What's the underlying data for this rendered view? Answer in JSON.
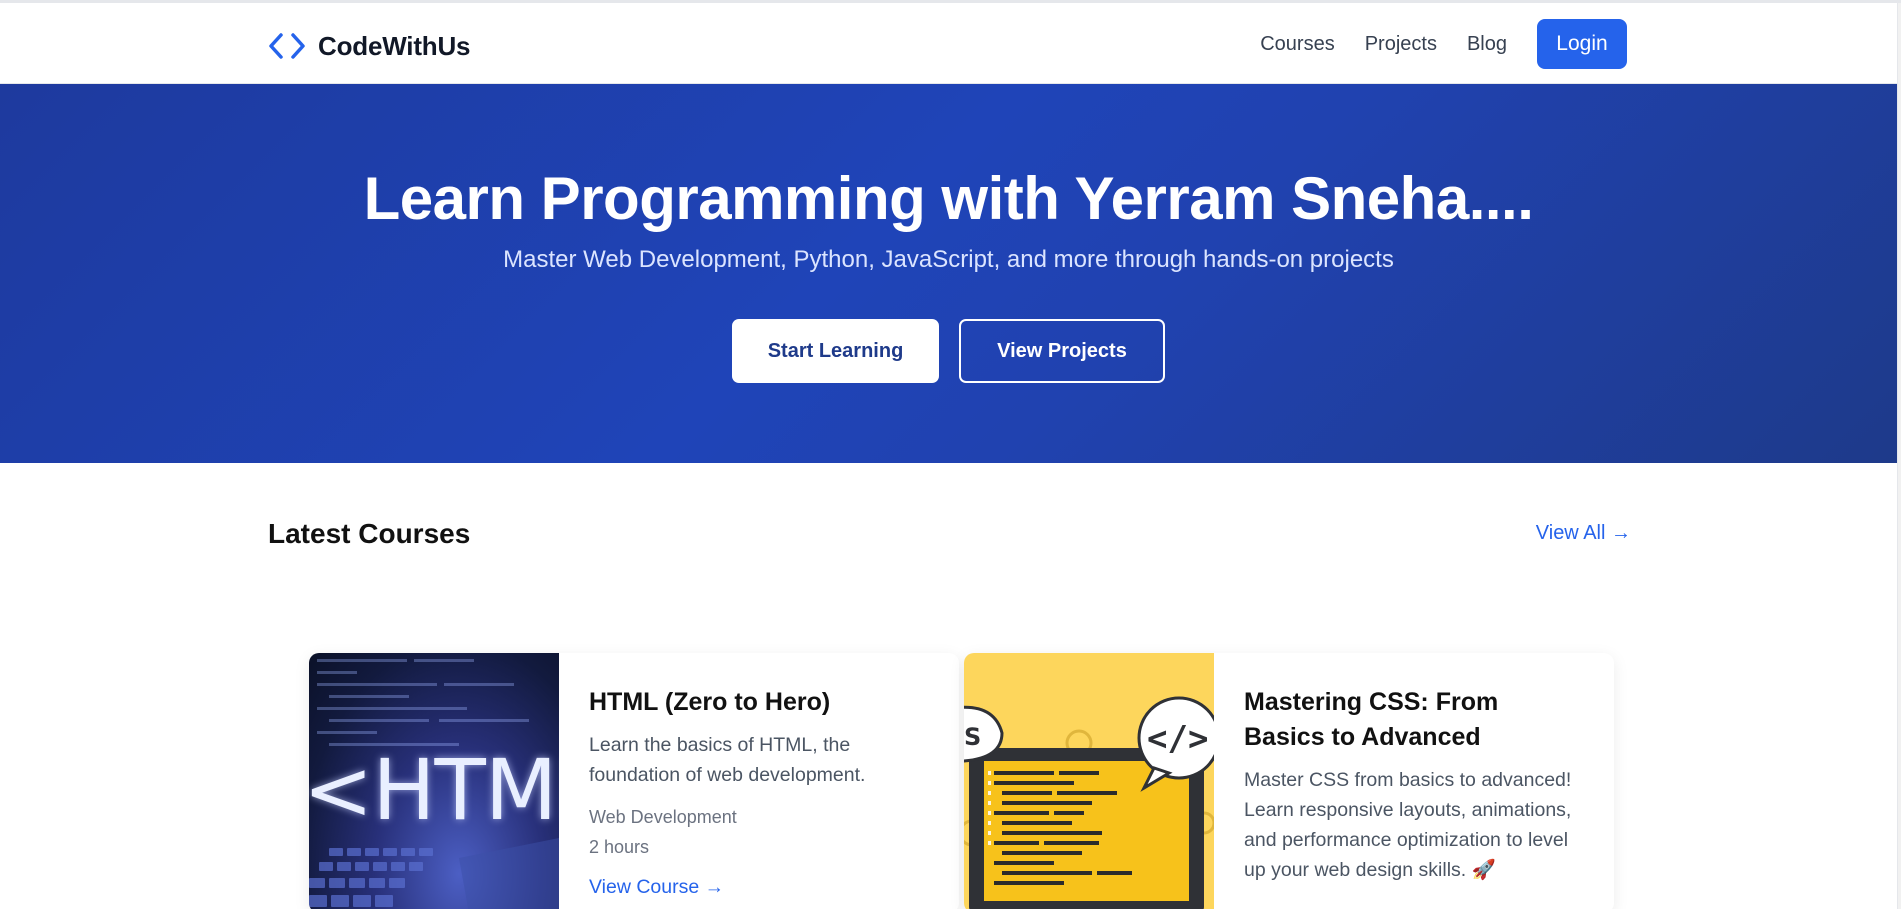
{
  "brand": {
    "name": "CodeWithUs",
    "icon": "code-brackets-icon"
  },
  "nav": {
    "links": [
      "Courses",
      "Projects",
      "Blog"
    ],
    "login_label": "Login"
  },
  "hero": {
    "title": "Learn Programming with Yerram Sneha....",
    "subtitle": "Master Web Development, Python, JavaScript, and more through hands-on projects",
    "primary_button": "Start Learning",
    "secondary_button": "View Projects"
  },
  "courses_section": {
    "title": "Latest Courses",
    "view_all": "View All →",
    "courses": [
      {
        "image_text": "HTML",
        "title": "HTML (Zero to Hero)",
        "description": "Learn the basics of HTML, the foundation of web development.",
        "category": "Web Development",
        "duration": "2 hours",
        "link": "View Course →"
      },
      {
        "image_text": "</>",
        "title": "Mastering CSS: From Basics to Advanced",
        "description": "Master CSS from basics to advanced! Learn responsive layouts, animations, and performance optimization to level up your web design skills. 🚀"
      }
    ]
  },
  "colors": {
    "accent": "#2563eb",
    "hero_bg": "#1e40af",
    "text_dark": "#111827"
  }
}
